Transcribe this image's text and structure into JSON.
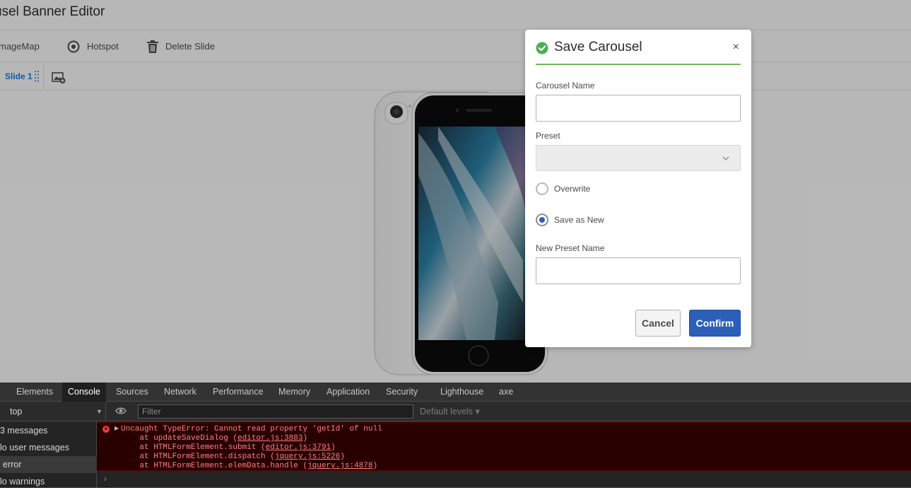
{
  "app": {
    "title": "usel Banner Editor"
  },
  "toolbar": {
    "imagemap_label": "mageMap",
    "hotspot_label": "Hotspot",
    "delete_slide_label": "Delete Slide"
  },
  "slides": {
    "tab_label": "Slide 1"
  },
  "dialog": {
    "title": "Save Carousel",
    "close_glyph": "×",
    "carousel_name_label": "Carousel Name",
    "carousel_name_value": "",
    "preset_label": "Preset",
    "preset_value": "",
    "overwrite_label": "Overwrite",
    "save_as_new_label": "Save as New",
    "selected_option": "Save as New",
    "new_preset_name_label": "New Preset Name",
    "new_preset_name_value": "",
    "cancel_label": "Cancel",
    "confirm_label": "Confirm",
    "accent_color": "#7ab55c",
    "button_color": "#2c5fb8"
  },
  "devtools": {
    "tabs": [
      "Elements",
      "Console",
      "Sources",
      "Network",
      "Performance",
      "Memory",
      "Application",
      "Security",
      "Lighthouse",
      "axe"
    ],
    "active_tab": "Console",
    "context": "top",
    "filter_placeholder": "Filter",
    "levels_label": "Default levels ▾",
    "sidebar": [
      "3 messages",
      "lo user messages",
      "error",
      "lo warnings"
    ],
    "error": {
      "message": "Uncaught TypeError: Cannot read property 'getId' of null",
      "stack": [
        {
          "prefix": "    at updateSaveDialog (",
          "link": "editor.js:3883",
          "suffix": ")"
        },
        {
          "prefix": "    at HTMLFormElement.submit (",
          "link": "editor.js:3791",
          "suffix": ")"
        },
        {
          "prefix": "    at HTMLFormElement.dispatch (",
          "link": "jquery.js:5226",
          "suffix": ")"
        },
        {
          "prefix": "    at HTMLFormElement.elemData.handle (",
          "link": "jquery.js:4878",
          "suffix": ")"
        }
      ],
      "color": "#ff8080"
    },
    "prompt_glyph": "›"
  },
  "icons": {
    "hotspot": "target-icon",
    "delete": "trash-icon",
    "success": "check-circle-icon"
  }
}
